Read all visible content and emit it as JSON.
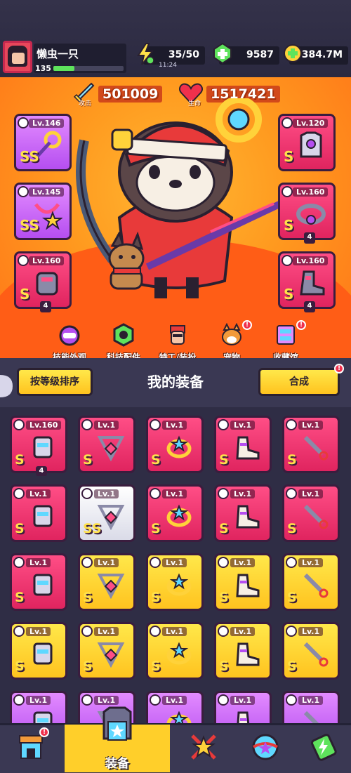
{
  "player": {
    "name": "懒虫一只",
    "level": "135",
    "xp_fraction": 0.3
  },
  "resources": {
    "energy": "35/50",
    "energy_timer": "11:24",
    "gems": "9587",
    "coins": "384.7M"
  },
  "hero_stats": {
    "attack_value": "501009",
    "attack_label": "攻击",
    "health_value": "1517421",
    "health_label": "生命"
  },
  "equipped_left": [
    {
      "lv": "Lv.146",
      "grade": "SS",
      "color": "purple"
    },
    {
      "lv": "Lv.145",
      "grade": "SS",
      "color": "purple"
    },
    {
      "lv": "Lv.160",
      "grade": "S",
      "color": "red",
      "count": "4"
    }
  ],
  "equipped_right": [
    {
      "lv": "Lv.120",
      "grade": "S",
      "color": "red"
    },
    {
      "lv": "Lv.160",
      "grade": "S",
      "color": "red",
      "count": "4"
    },
    {
      "lv": "Lv.160",
      "grade": "S",
      "color": "red",
      "count": "4"
    }
  ],
  "hero_menu": [
    {
      "label": "技能外观",
      "alert": false
    },
    {
      "label": "科技配件",
      "alert": false
    },
    {
      "label": "特工/装扮",
      "alert": false
    },
    {
      "label": "宠物",
      "alert": true
    },
    {
      "label": "收藏馆",
      "alert": true
    }
  ],
  "equipment": {
    "sort_label": "按等级排序",
    "title": "我的装备",
    "merge_label": "合成",
    "alert_mark": "!",
    "items": [
      {
        "lv": "Lv.160",
        "grade": "S",
        "color": "red",
        "count": "4"
      },
      {
        "lv": "Lv.1",
        "grade": "S",
        "color": "red"
      },
      {
        "lv": "Lv.1",
        "grade": "S",
        "color": "red"
      },
      {
        "lv": "Lv.1",
        "grade": "S",
        "color": "red"
      },
      {
        "lv": "Lv.1",
        "grade": "S",
        "color": "red"
      },
      {
        "lv": "Lv.1",
        "grade": "S",
        "color": "red"
      },
      {
        "lv": "Lv.1",
        "grade": "SS",
        "color": "white"
      },
      {
        "lv": "Lv.1",
        "grade": "S",
        "color": "red"
      },
      {
        "lv": "Lv.1",
        "grade": "S",
        "color": "red"
      },
      {
        "lv": "Lv.1",
        "grade": "S",
        "color": "red"
      },
      {
        "lv": "Lv.1",
        "grade": "S",
        "color": "red"
      },
      {
        "lv": "Lv.1",
        "grade": "S",
        "color": "yellow"
      },
      {
        "lv": "Lv.1",
        "grade": "S",
        "color": "yellow"
      },
      {
        "lv": "Lv.1",
        "grade": "S",
        "color": "yellow"
      },
      {
        "lv": "Lv.1",
        "grade": "S",
        "color": "yellow"
      },
      {
        "lv": "Lv.1",
        "grade": "S",
        "color": "yellow"
      },
      {
        "lv": "Lv.1",
        "grade": "S",
        "color": "yellow"
      },
      {
        "lv": "Lv.1",
        "grade": "S",
        "color": "yellow"
      },
      {
        "lv": "Lv.1",
        "grade": "S",
        "color": "yellow"
      },
      {
        "lv": "Lv.1",
        "grade": "S",
        "color": "yellow"
      },
      {
        "lv": "Lv.1",
        "grade": "",
        "color": "purple"
      },
      {
        "lv": "Lv.1",
        "grade": "",
        "color": "purple"
      },
      {
        "lv": "Lv.1",
        "grade": "",
        "color": "purple"
      },
      {
        "lv": "Lv.1",
        "grade": "",
        "color": "purple"
      },
      {
        "lv": "Lv.1",
        "grade": "",
        "color": "purple"
      }
    ]
  },
  "bottom_nav": [
    {
      "label": "",
      "icon": "shop-icon",
      "active": false,
      "alert": true
    },
    {
      "label": "装备",
      "icon": "equipment-icon",
      "active": true,
      "alert": false
    },
    {
      "label": "",
      "icon": "star-weapons-icon",
      "active": false,
      "alert": false
    },
    {
      "label": "",
      "icon": "pets-ball-icon",
      "active": false,
      "alert": false
    },
    {
      "label": "",
      "icon": "battery-icon",
      "active": false,
      "alert": false
    }
  ],
  "colors": {
    "red_card": "#e0245f",
    "yellow_card": "#ffc31f",
    "purple_card": "#b54ef0",
    "accent_yellow": "#ffcf2a",
    "hero_bg": "#ff9a1f"
  }
}
